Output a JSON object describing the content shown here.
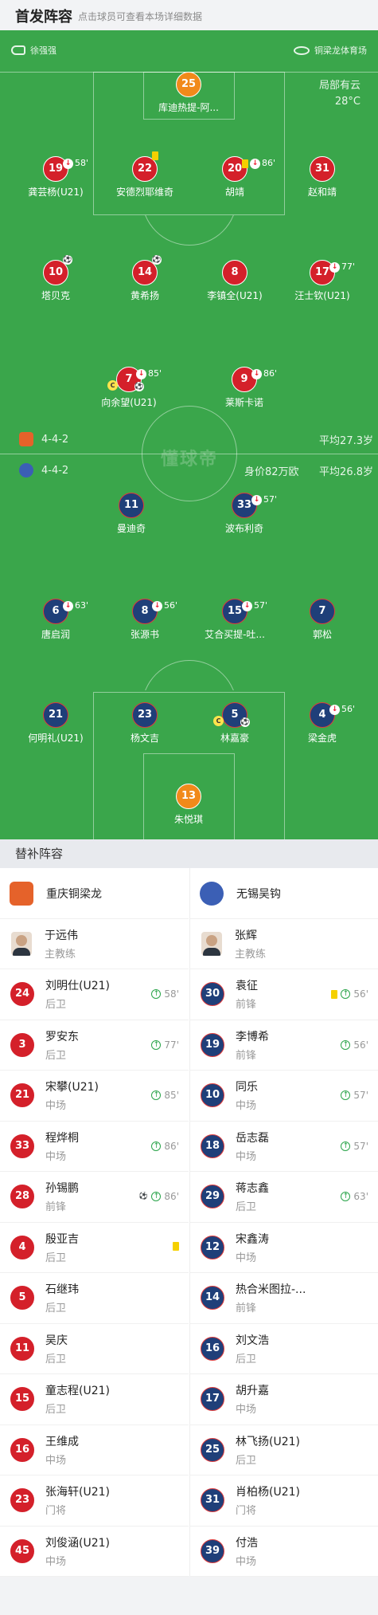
{
  "header": {
    "title": "首发阵容",
    "subtitle": "点击球员可查看本场详细数据"
  },
  "match": {
    "referee": "徐强强",
    "venue": "铜梁龙体育场",
    "weather": "局部有云",
    "temperature": "28°C"
  },
  "home": {
    "formation": "4-4-2",
    "avg_age": "平均27.3岁",
    "color": "#d4202a"
  },
  "away": {
    "formation": "4-4-2",
    "value": "身价82万欧",
    "avg_age": "平均26.8岁",
    "color": "#1f3f79"
  },
  "watermark": "懂球帝",
  "home_players": [
    {
      "num": "25",
      "name": "库迪热提-阿...",
      "badges": []
    },
    {
      "num": "19",
      "name": "龚芸杨(U21)",
      "badges": [
        "sub",
        "58'"
      ]
    },
    {
      "num": "22",
      "name": "安德烈耶维奇",
      "badges": [
        "yc"
      ]
    },
    {
      "num": "20",
      "name": "胡靖",
      "badges": [
        "yc",
        "sub",
        "86'"
      ]
    },
    {
      "num": "31",
      "name": "赵和靖",
      "badges": []
    },
    {
      "num": "10",
      "name": "塔贝克",
      "badges": [
        "ball"
      ]
    },
    {
      "num": "14",
      "name": "黄希扬",
      "badges": [
        "ball"
      ]
    },
    {
      "num": "8",
      "name": "李镇全(U21)",
      "badges": []
    },
    {
      "num": "17",
      "name": "汪士钦(U21)",
      "badges": [
        "sub",
        "77'"
      ]
    },
    {
      "num": "7",
      "name": "向余望(U21)",
      "badges": [
        "sub",
        "85'"
      ]
    },
    {
      "num": "9",
      "name": "莱斯卡诺",
      "badges": [
        "sub",
        "86'"
      ]
    }
  ],
  "away_players": [
    {
      "num": "11",
      "name": "曼迪奇",
      "badges": []
    },
    {
      "num": "33",
      "name": "波布利奇",
      "badges": [
        "sub",
        "57'"
      ]
    },
    {
      "num": "6",
      "name": "唐启润",
      "badges": [
        "sub",
        "63'"
      ]
    },
    {
      "num": "8",
      "name": "张源书",
      "badges": [
        "sub",
        "56'"
      ]
    },
    {
      "num": "15",
      "name": "艾合买提-吐...",
      "badges": [
        "sub",
        "57'"
      ]
    },
    {
      "num": "7",
      "name": "郭松",
      "badges": []
    },
    {
      "num": "21",
      "name": "何明礼(U21)",
      "badges": []
    },
    {
      "num": "23",
      "name": "杨文吉",
      "badges": []
    },
    {
      "num": "5",
      "name": "林嘉豪",
      "badges": []
    },
    {
      "num": "4",
      "name": "梁金虎",
      "badges": [
        "sub",
        "56'"
      ]
    },
    {
      "num": "13",
      "name": "朱悦琪",
      "badges": []
    }
  ],
  "subs": {
    "title": "替补阵容",
    "home_team": "重庆铜梁龙",
    "away_team": "无锡吴钩",
    "home_coach": {
      "name": "于远伟",
      "role": "主教练"
    },
    "away_coach": {
      "name": "张辉",
      "role": "主教练"
    },
    "home": [
      {
        "num": "24",
        "name": "刘明仕(U21)",
        "pos": "后卫",
        "ev": "58'"
      },
      {
        "num": "3",
        "name": "罗安东",
        "pos": "后卫",
        "ev": "77'"
      },
      {
        "num": "21",
        "name": "宋攀(U21)",
        "pos": "中场",
        "ev": "85'"
      },
      {
        "num": "33",
        "name": "程烨桐",
        "pos": "中场",
        "ev": "86'"
      },
      {
        "num": "28",
        "name": "孙锡鹏",
        "pos": "前锋",
        "ev": "86'"
      },
      {
        "num": "4",
        "name": "殷亚吉",
        "pos": "后卫",
        "ev": ""
      },
      {
        "num": "5",
        "name": "石继玮",
        "pos": "后卫",
        "ev": ""
      },
      {
        "num": "11",
        "name": "吴庆",
        "pos": "后卫",
        "ev": ""
      },
      {
        "num": "15",
        "name": "童志程(U21)",
        "pos": "后卫",
        "ev": ""
      },
      {
        "num": "16",
        "name": "王维成",
        "pos": "中场",
        "ev": ""
      },
      {
        "num": "23",
        "name": "张海轩(U21)",
        "pos": "门将",
        "ev": ""
      },
      {
        "num": "45",
        "name": "刘俊涵(U21)",
        "pos": "中场",
        "ev": ""
      }
    ],
    "away": [
      {
        "num": "30",
        "name": "袁征",
        "pos": "前锋",
        "ev": "56'"
      },
      {
        "num": "19",
        "name": "李博希",
        "pos": "前锋",
        "ev": "56'"
      },
      {
        "num": "10",
        "name": "同乐",
        "pos": "中场",
        "ev": "57'"
      },
      {
        "num": "18",
        "name": "岳志磊",
        "pos": "中场",
        "ev": "57'"
      },
      {
        "num": "29",
        "name": "蒋志鑫",
        "pos": "后卫",
        "ev": "63'"
      },
      {
        "num": "12",
        "name": "宋鑫涛",
        "pos": "中场",
        "ev": ""
      },
      {
        "num": "14",
        "name": "热合米图拉-...",
        "pos": "前锋",
        "ev": ""
      },
      {
        "num": "16",
        "name": "刘文浩",
        "pos": "后卫",
        "ev": ""
      },
      {
        "num": "17",
        "name": "胡升嘉",
        "pos": "中场",
        "ev": ""
      },
      {
        "num": "25",
        "name": "林飞扬(U21)",
        "pos": "后卫",
        "ev": ""
      },
      {
        "num": "31",
        "name": "肖柏杨(U21)",
        "pos": "门将",
        "ev": ""
      },
      {
        "num": "39",
        "name": "付浩",
        "pos": "中场",
        "ev": ""
      }
    ]
  }
}
